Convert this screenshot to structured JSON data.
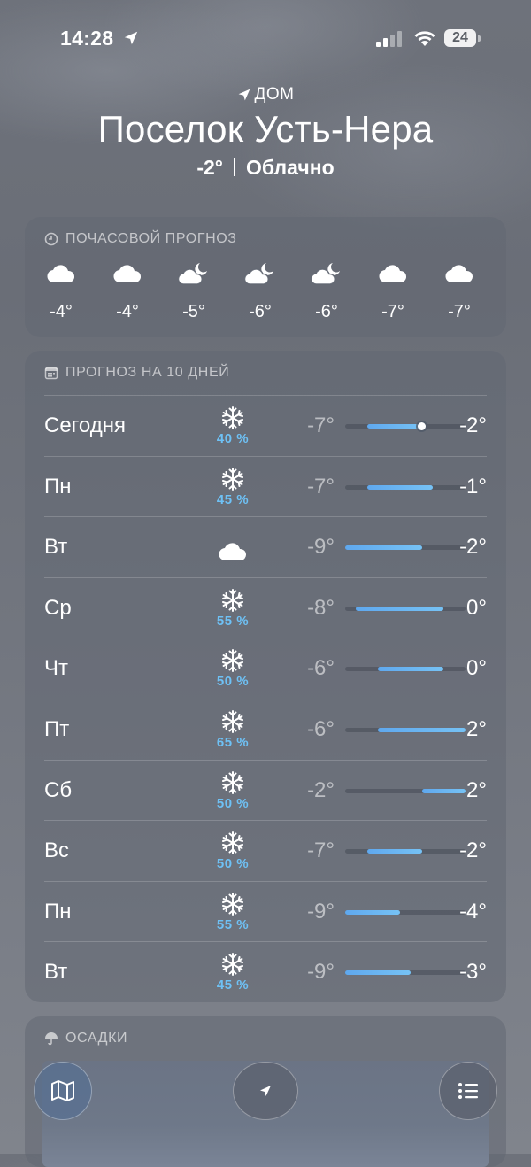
{
  "status": {
    "time": "14:28",
    "battery": "24"
  },
  "header": {
    "home_label": "ДОМ",
    "city": "Поселок Усть-Нера",
    "temp": "-2°",
    "condition": "Облачно"
  },
  "hourly": {
    "title": "ПОЧАСОВОЙ ПРОГНОЗ",
    "items": [
      {
        "icon": "cloud-icon",
        "temp": "-4°"
      },
      {
        "icon": "cloud-icon",
        "temp": "-4°"
      },
      {
        "icon": "cloud-moon-icon",
        "temp": "-5°"
      },
      {
        "icon": "cloud-moon-icon",
        "temp": "-6°"
      },
      {
        "icon": "cloud-moon-icon",
        "temp": "-6°"
      },
      {
        "icon": "cloud-icon",
        "temp": "-7°"
      },
      {
        "icon": "cloud-icon",
        "temp": "-7°"
      }
    ]
  },
  "daily": {
    "title": "ПРОГНОЗ НА 10 ДНЕЙ",
    "range_min": -9,
    "range_max": 2,
    "days": [
      {
        "day": "Сегодня",
        "icon": "snowflake-icon",
        "pct": "40 %",
        "lo": "-7°",
        "hi": "-2°",
        "lo_v": -7,
        "hi_v": -2,
        "current": -2
      },
      {
        "day": "Пн",
        "icon": "snowflake-icon",
        "pct": "45 %",
        "lo": "-7°",
        "hi": "-1°",
        "lo_v": -7,
        "hi_v": -1
      },
      {
        "day": "Вт",
        "icon": "cloud-icon",
        "pct": "",
        "lo": "-9°",
        "hi": "-2°",
        "lo_v": -9,
        "hi_v": -2
      },
      {
        "day": "Ср",
        "icon": "snowflake-icon",
        "pct": "55 %",
        "lo": "-8°",
        "hi": "0°",
        "lo_v": -8,
        "hi_v": 0
      },
      {
        "day": "Чт",
        "icon": "snowflake-icon",
        "pct": "50 %",
        "lo": "-6°",
        "hi": "0°",
        "lo_v": -6,
        "hi_v": 0
      },
      {
        "day": "Пт",
        "icon": "snowflake-icon",
        "pct": "65 %",
        "lo": "-6°",
        "hi": "2°",
        "lo_v": -6,
        "hi_v": 2
      },
      {
        "day": "Сб",
        "icon": "snowflake-icon",
        "pct": "50 %",
        "lo": "-2°",
        "hi": "2°",
        "lo_v": -2,
        "hi_v": 2
      },
      {
        "day": "Вс",
        "icon": "snowflake-icon",
        "pct": "50 %",
        "lo": "-7°",
        "hi": "-2°",
        "lo_v": -7,
        "hi_v": -2
      },
      {
        "day": "Пн",
        "icon": "snowflake-icon",
        "pct": "55 %",
        "lo": "-9°",
        "hi": "-4°",
        "lo_v": -9,
        "hi_v": -4
      },
      {
        "day": "Вт",
        "icon": "snowflake-icon",
        "pct": "45 %",
        "lo": "-9°",
        "hi": "-3°",
        "lo_v": -9,
        "hi_v": -3
      }
    ]
  },
  "precip": {
    "title": "ОСАДКИ"
  },
  "toolbar": {
    "map": "map-icon",
    "location": "location-arrow-icon",
    "list": "list-icon"
  }
}
